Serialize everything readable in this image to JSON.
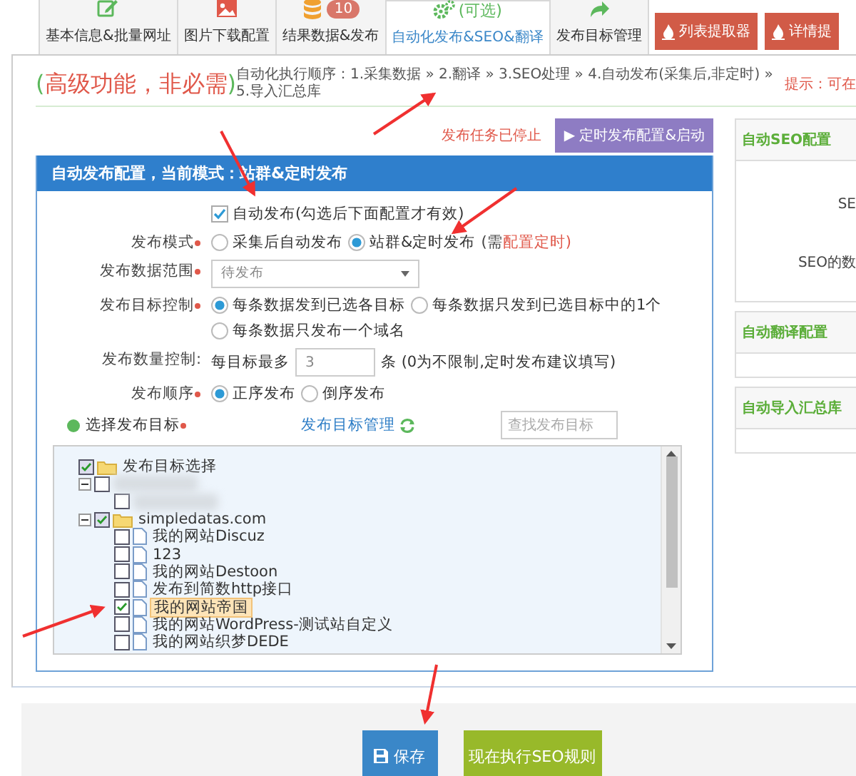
{
  "tabs": [
    {
      "label": "基本信息&批量网址",
      "selected": false
    },
    {
      "label": "图片下载配置",
      "selected": false
    },
    {
      "badge": "10",
      "label": "结果数据&发布",
      "selected": false
    },
    {
      "note": "(可选)",
      "label": "自动化发布&SEO&翻译",
      "selected": true
    },
    {
      "label": "发布目标管理",
      "selected": false
    }
  ],
  "tool_buttons": [
    "列表提取器",
    "详情提"
  ],
  "heading": {
    "paren_open": "(",
    "text": "高级功能，非必需",
    "paren_close": ")",
    "order": "自动化执行顺序：1.采集数据 » 2.翻译 » 3.SEO处理 » 4.自动发布(采集后,非定时) » 5.导入汇总库",
    "hint": "提示：可在"
  },
  "publish_status": {
    "status": "发布任务已停止",
    "schedule_button": "▶ 定时发布配置&启动"
  },
  "config_panel": {
    "title": "自动发布配置，当前模式：站群&定时发布",
    "rows": [
      {
        "kind": "checkbox",
        "text": "自动发布(勾选后下面配置才有效)",
        "checked": true
      },
      {
        "kind": "radio",
        "label": "发布模式",
        "required": true,
        "options": [
          {
            "text": "采集后自动发布",
            "selected": false
          },
          {
            "text": "站群&定时发布",
            "selected": true
          }
        ],
        "note": "(需",
        "note_link": "配置定时)"
      },
      {
        "kind": "select",
        "label": "发布数据范围",
        "required": true,
        "value": "待发布"
      },
      {
        "kind": "radio",
        "label": "发布目标控制",
        "required": true,
        "options": [
          {
            "text": "每条数据发到已选各目标",
            "selected": true
          },
          {
            "text": "每条数据只发到已选目标中的1个",
            "selected": false
          },
          {
            "text": "每条数据只发布一个域名",
            "selected": false
          }
        ]
      },
      {
        "kind": "number",
        "label": "发布数量控制:",
        "required": false,
        "prefix": "每目标最多",
        "value": "3",
        "suffix": "条 (0为不限制,定时发布建议填写)"
      },
      {
        "kind": "radio",
        "label": "发布顺序",
        "required": true,
        "options": [
          {
            "text": "正序发布",
            "selected": true
          },
          {
            "text": "倒序发布",
            "selected": false
          }
        ]
      }
    ],
    "target_label": "选择发布目标",
    "target_link": "发布目标管理",
    "search_placeholder": "查找发布目标",
    "tree": {
      "label": "发布目标选择",
      "checked": true,
      "expanded": true,
      "children": [
        {
          "redacted": true,
          "checked": false,
          "expanded": true,
          "children": [
            {
              "redacted": true,
              "checked": false
            }
          ]
        },
        {
          "label": "simpledatas.com",
          "checked": true,
          "expanded": true,
          "children": [
            {
              "label": "我的网站Discuz",
              "checked": false,
              "selected": false
            },
            {
              "label": "123",
              "checked": false,
              "selected": false
            },
            {
              "label": "我的网站Destoon",
              "checked": false,
              "selected": false
            },
            {
              "label": "发布到简数http接口",
              "checked": false,
              "selected": false
            },
            {
              "label": "我的网站帝国",
              "checked": true,
              "selected": true
            },
            {
              "label": "我的网站WordPress-测试站自定义",
              "checked": false,
              "selected": false
            },
            {
              "label": "我的网站织梦DEDE",
              "checked": false,
              "selected": false
            }
          ]
        }
      ]
    }
  },
  "side_panels": [
    {
      "title": "自动SEO配置",
      "lines": [
        "SE",
        "SEO的数"
      ]
    },
    {
      "title": "自动翻译配置"
    },
    {
      "title": "自动导入汇总库"
    }
  ],
  "footer_buttons": [
    {
      "kind": "save",
      "label": "保存"
    },
    {
      "kind": "run",
      "label": "现在执行SEO规则"
    }
  ]
}
